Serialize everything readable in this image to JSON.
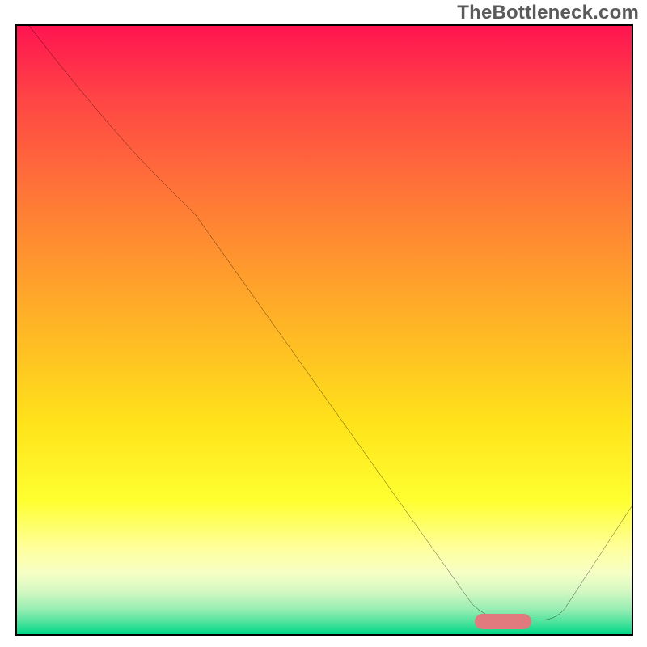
{
  "watermark": "TheBottleneck.com",
  "chart_data": {
    "type": "line",
    "title": "",
    "xlabel": "",
    "ylabel": "",
    "xlim": [
      0,
      100
    ],
    "ylim": [
      0,
      100
    ],
    "background_gradient": {
      "direction": "top-to-bottom",
      "stops": [
        {
          "pos": 0.0,
          "color": "#ff1450",
          "meaning": "severe-bottleneck"
        },
        {
          "pos": 0.12,
          "color": "#ff4545"
        },
        {
          "pos": 0.3,
          "color": "#ff7d35"
        },
        {
          "pos": 0.5,
          "color": "#ffb725"
        },
        {
          "pos": 0.65,
          "color": "#ffe21a"
        },
        {
          "pos": 0.78,
          "color": "#ffff30"
        },
        {
          "pos": 0.86,
          "color": "#ffff9e"
        },
        {
          "pos": 0.9,
          "color": "#f6ffc6"
        },
        {
          "pos": 0.93,
          "color": "#d4f8c2"
        },
        {
          "pos": 0.96,
          "color": "#95edb2"
        },
        {
          "pos": 0.98,
          "color": "#4fe39d"
        },
        {
          "pos": 1.0,
          "color": "#00d887",
          "meaning": "optimal"
        }
      ]
    },
    "series": [
      {
        "name": "bottleneck-curve",
        "points": [
          {
            "x": 2,
            "y": 100
          },
          {
            "x": 25,
            "y": 73
          },
          {
            "x": 29,
            "y": 69
          },
          {
            "x": 74,
            "y": 5
          },
          {
            "x": 80,
            "y": 2.3
          },
          {
            "x": 85,
            "y": 2.3
          },
          {
            "x": 89,
            "y": 4
          },
          {
            "x": 100,
            "y": 21
          }
        ]
      }
    ],
    "annotations": [
      {
        "name": "optimal-range-marker",
        "shape": "rounded-rect",
        "color": "#e17a7f",
        "x_range": [
          75,
          84
        ],
        "y": 3
      }
    ]
  }
}
